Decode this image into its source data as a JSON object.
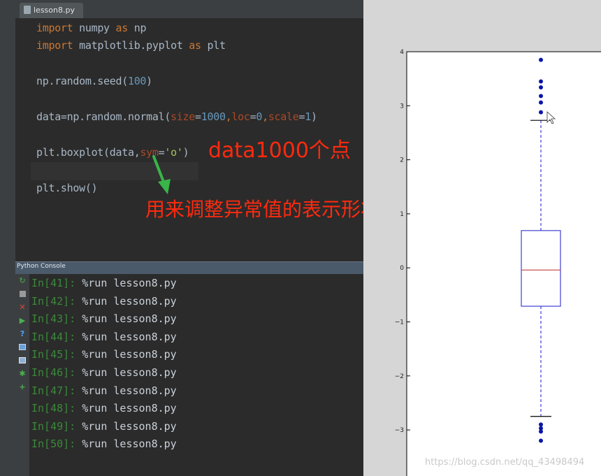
{
  "tab": {
    "filename": "lesson8.py"
  },
  "code": {
    "l1_kw1": "import",
    "l1_mod": " numpy ",
    "l1_kw2": "as",
    "l1_alias": " np",
    "l2_kw1": "import",
    "l2_mod": " matplotlib.pyplot ",
    "l2_kw2": "as",
    "l2_alias": " plt",
    "l3_a": "np.random.seed(",
    "l3_num": "100",
    "l3_b": ")",
    "l4_a": "data=np.random.normal(",
    "l4_k1": "size",
    "l4_eq1": "=",
    "l4_v1": "1000",
    "l4_c1": ",",
    "l4_k2": "loc",
    "l4_eq2": "=",
    "l4_v2": "0",
    "l4_c2": ",",
    "l4_k3": "scale",
    "l4_eq3": "=",
    "l4_v3": "1",
    "l4_b": ")",
    "l5_a": "plt.boxplot(data,",
    "l5_k": "sym",
    "l5_eq": "=",
    "l5_s": "'o'",
    "l5_b": ")",
    "l6": "plt.show()"
  },
  "annotations": {
    "note1": "data1000个点",
    "note2": "用来调整异常值的表示形状"
  },
  "console": {
    "title": "Python Console",
    "rows": [
      {
        "prompt": "In[41]:",
        "command": "%run lesson8.py"
      },
      {
        "prompt": "In[42]:",
        "command": "%run lesson8.py"
      },
      {
        "prompt": "In[43]:",
        "command": "%run lesson8.py"
      },
      {
        "prompt": "In[44]:",
        "command": "%run lesson8.py"
      },
      {
        "prompt": "In[45]:",
        "command": "%run lesson8.py"
      },
      {
        "prompt": "In[46]:",
        "command": "%run lesson8.py"
      },
      {
        "prompt": "In[47]:",
        "command": "%run lesson8.py"
      },
      {
        "prompt": "In[48]:",
        "command": "%run lesson8.py"
      },
      {
        "prompt": "In[49]:",
        "command": "%run lesson8.py"
      },
      {
        "prompt": "In[50]:",
        "command": "%run lesson8.py"
      }
    ],
    "toolbar_icons": [
      "rerun-icon",
      "stop-icon",
      "close-icon",
      "run-icon",
      "help-icon",
      "variables-icon",
      "settings-icon",
      "debug-icon",
      "add-icon"
    ]
  },
  "chart_data": {
    "type": "boxplot",
    "title": "",
    "xlabel": "",
    "ylabel": "",
    "ylim": [
      -3.6,
      4.0
    ],
    "yticks": [
      -3,
      -2,
      -1,
      0,
      1,
      2,
      3,
      4
    ],
    "ytick_labels": [
      "−3",
      "−2",
      "−1",
      "0",
      "1",
      "2",
      "3",
      "4"
    ],
    "series": [
      {
        "q1": -0.71,
        "median": -0.04,
        "q3": 0.69,
        "whisker_low": -2.75,
        "whisker_high": 2.73,
        "outliers": [
          3.85,
          3.45,
          3.34,
          3.18,
          3.06,
          2.88,
          -2.9,
          -2.97,
          -3.03,
          -3.2
        ]
      }
    ],
    "colors": {
      "box": "#4040d0",
      "median": "#c04040",
      "whisker": "#3a3ad6",
      "flier": "#0a16a8",
      "cap": "#000000"
    },
    "grid": false
  },
  "watermark": "https://blog.csdn.net/qq_43498494"
}
